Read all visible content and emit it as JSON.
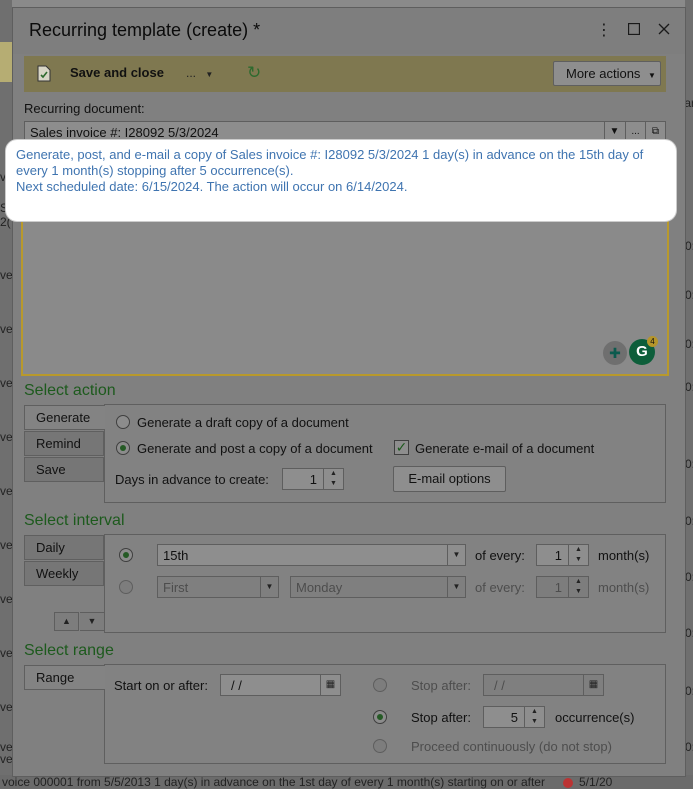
{
  "background": {
    "left_fragments": [
      "S",
      "2(",
      "ve",
      "ve",
      "ve",
      "ve",
      "ve",
      "ve",
      "ve",
      "ve",
      "ve",
      "ve",
      "ve",
      "ve"
    ],
    "right_fragments": [
      "ar",
      "0:",
      "0:",
      "0:",
      "0:",
      "0:",
      "0:",
      "0:",
      "0:",
      "0:",
      "0:"
    ],
    "bottom_text": "voice 000001 from 5/5/2013 1 day(s) in advance on the 1st day of every 1 month(s) starting on or after",
    "bottom_right": "5/1/20"
  },
  "window": {
    "title": "Recurring template (create) *",
    "menu_icon": "kebab-menu-icon",
    "maximize_icon": "maximize-icon",
    "close_icon": "close-icon"
  },
  "toolbar": {
    "save_close_label": "Save and close",
    "more_label": "...",
    "refresh_icon": "refresh-icon",
    "more_actions_label": "More actions"
  },
  "recurring_document": {
    "label": "Recurring document:",
    "value": "Sales invoice #: I28092 5/3/2024"
  },
  "description": {
    "line1": "Generate, post, and e-mail a copy of Sales invoice #: I28092 5/3/2024 1 day(s) in advance on the 15th day of every 1 month(s) stopping after 5 occurrence(s).",
    "line2": "Next scheduled date: 6/15/2024. The action will occur on 6/14/2024.",
    "grammarly_count": "4"
  },
  "select_action": {
    "title": "Select action",
    "tabs": [
      "Generate",
      "Remind",
      "Save"
    ],
    "option_draft": "Generate a draft copy of a document",
    "option_post": "Generate and post a copy of a document",
    "option_email": "Generate e-mail of a document",
    "days_label": "Days in advance to create:",
    "days_value": "1",
    "email_options_label": "E-mail options"
  },
  "select_interval": {
    "title": "Select interval",
    "tabs": [
      "Daily",
      "Weekly"
    ],
    "day_value": "15th",
    "of_every_label": "of every:",
    "months_value": "1",
    "months_label": "month(s)",
    "ordinal_value": "First",
    "weekday_value": "Monday",
    "months_value2": "1"
  },
  "select_range": {
    "title": "Select range",
    "tab": "Range",
    "start_label": "Start on or after:",
    "start_value": "/  /",
    "stop_after_date_label": "Stop after:",
    "stop_after_date_value": "/  /",
    "stop_after_count_label": "Stop after:",
    "stop_after_count_value": "5",
    "occurrences_label": "occurrence(s)",
    "proceed_label": "Proceed continuously (do not stop)"
  },
  "colors": {
    "accent_green": "#1d5a1d",
    "link_blue": "#3f74b0",
    "highlight_border": "#b8992c"
  }
}
